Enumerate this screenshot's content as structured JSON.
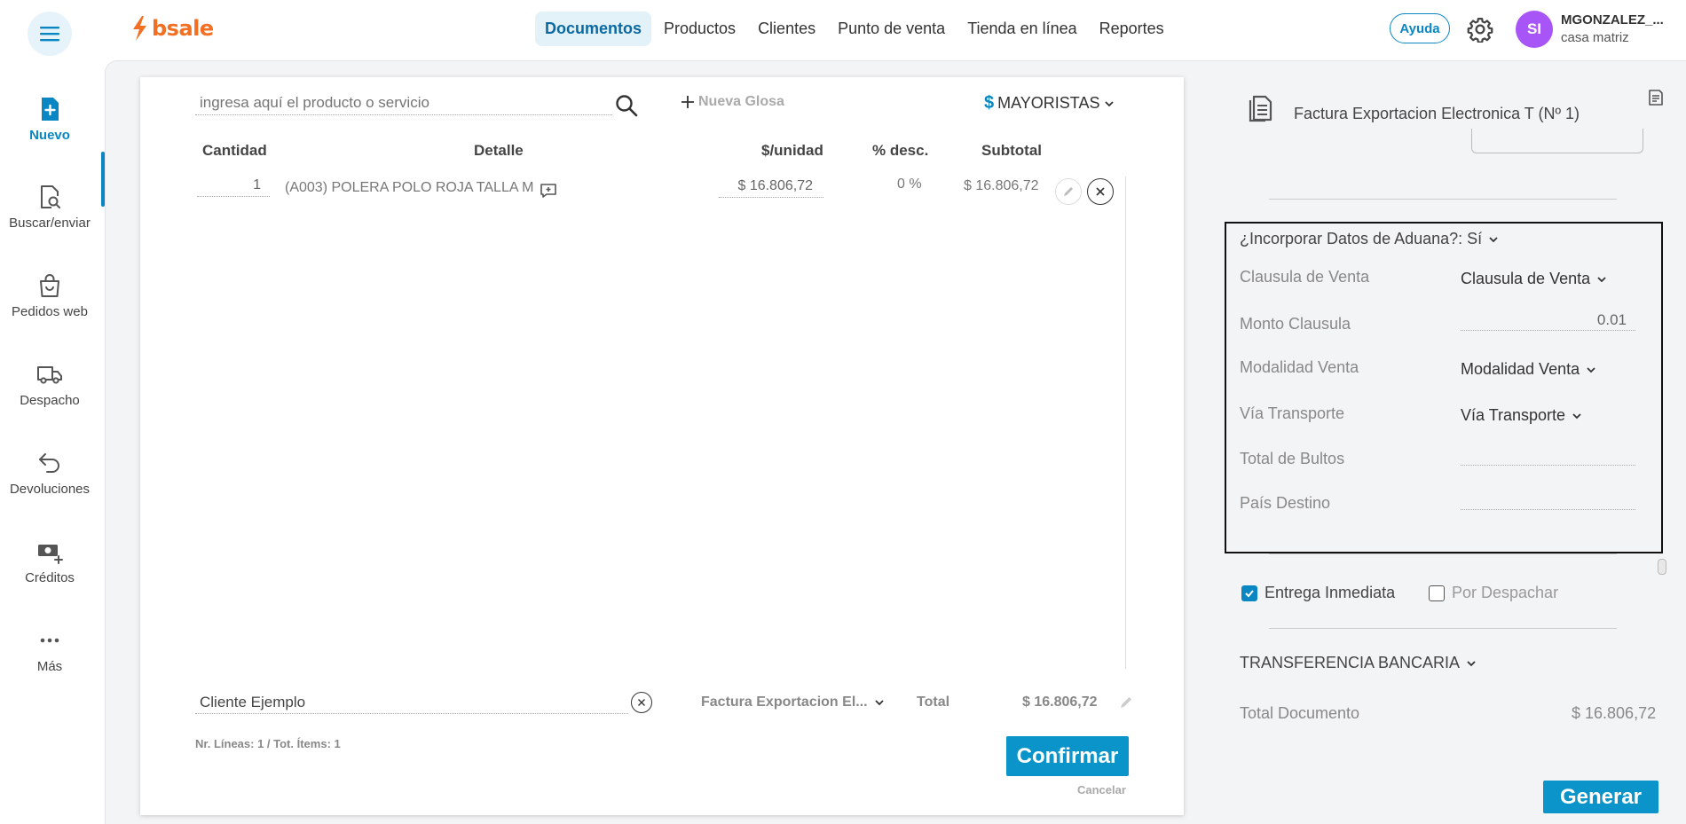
{
  "header": {
    "logo_text": "bsale",
    "nav": [
      {
        "label": "Documentos",
        "active": true
      },
      {
        "label": "Productos",
        "active": false
      },
      {
        "label": "Clientes",
        "active": false
      },
      {
        "label": "Punto de venta",
        "active": false
      },
      {
        "label": "Tienda en línea",
        "active": false
      },
      {
        "label": "Reportes",
        "active": false
      }
    ],
    "help_label": "Ayuda",
    "avatar_initials": "SI",
    "user_name": "MGONZALEZ_...",
    "user_branch": "casa matriz"
  },
  "sidebar": {
    "items": [
      {
        "label": "Nuevo",
        "icon": "new-document-icon",
        "active": true
      },
      {
        "label": "Buscar/enviar",
        "icon": "search-document-icon",
        "active": false
      },
      {
        "label": "Pedidos web",
        "icon": "shopping-bag-icon",
        "active": false
      },
      {
        "label": "Despacho",
        "icon": "truck-icon",
        "active": false
      },
      {
        "label": "Devoluciones",
        "icon": "return-arrow-icon",
        "active": false
      },
      {
        "label": "Créditos",
        "icon": "money-icon",
        "active": false
      },
      {
        "label": "Más",
        "icon": "more-icon",
        "active": false
      }
    ]
  },
  "document": {
    "search_placeholder": "ingresa aquí el producto o servicio",
    "new_gloss_label": "Nueva Glosa",
    "price_list_symbol": "$",
    "price_list_label": "MAYORISTAS",
    "columns": {
      "qty": "Cantidad",
      "detail": "Detalle",
      "unit_price": "$/unidad",
      "discount": "% desc.",
      "subtotal": "Subtotal"
    },
    "rows": [
      {
        "qty": "1",
        "detail": "(A003) POLERA POLO ROJA TALLA M",
        "unit_price": "$ 16.806,72",
        "discount": "0 %",
        "subtotal": "$ 16.806,72"
      }
    ],
    "client_value": "Cliente Ejemplo",
    "doc_type_short": "Factura Exportacion El...",
    "total_label": "Total",
    "total_value": "$ 16.806,72",
    "line_summary": "Nr. Líneas: 1 / Tot. Ítems: 1",
    "confirm_label": "Confirmar",
    "cancel_label": "Cancelar"
  },
  "panel": {
    "doc_title": "Factura Exportacion Electronica T (Nº 1)",
    "customs": {
      "heading": "¿Incorporar Datos de Aduana?: Sí",
      "fields": [
        {
          "label": "Clausula de Venta",
          "kind": "select",
          "value": "Clausula de Venta"
        },
        {
          "label": "Monto Clausula",
          "kind": "input",
          "value": "0.01"
        },
        {
          "label": "Modalidad Venta",
          "kind": "select",
          "value": "Modalidad Venta"
        },
        {
          "label": "Vía Transporte",
          "kind": "select",
          "value": "Vía Transporte"
        },
        {
          "label": "Total de Bultos",
          "kind": "input",
          "value": ""
        },
        {
          "label": "País Destino",
          "kind": "input",
          "value": ""
        }
      ]
    },
    "delivery_immediate": {
      "label": "Entrega Inmediata",
      "checked": true
    },
    "delivery_dispatch": {
      "label": "Por Despachar",
      "checked": false
    },
    "payment_method": "TRANSFERENCIA BANCARIA",
    "doc_total_label": "Total Documento",
    "doc_total_value": "$ 16.806,72",
    "generate_label": "Generar"
  },
  "colors": {
    "brand_orange": "#f36f21",
    "accent_blue": "#0a86c2",
    "button_blue": "#0a94c9",
    "avatar_purple": "#a855f7"
  }
}
